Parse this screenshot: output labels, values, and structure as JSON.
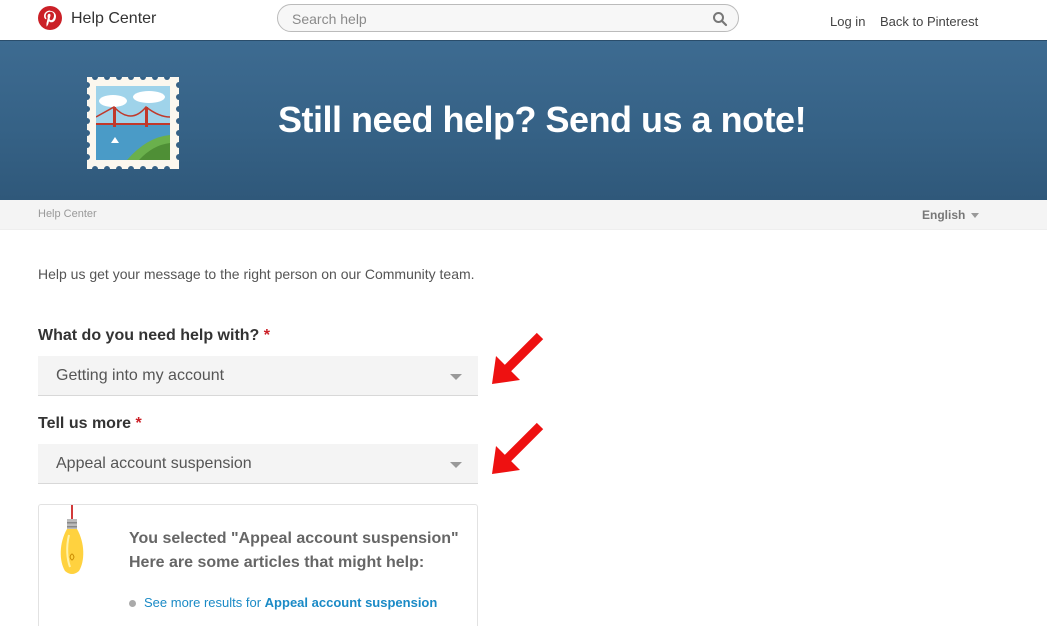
{
  "header": {
    "brand": "Help Center",
    "search_placeholder": "Search help",
    "login": "Log in",
    "back": "Back to Pinterest"
  },
  "banner": {
    "title": "Still need help? Send us a note!"
  },
  "crumbbar": {
    "breadcrumb": "Help Center",
    "language": "English"
  },
  "form": {
    "intro": "Help us get your message to the right person on our Community team.",
    "q1_label": "What do you need help with?",
    "q1_value": "Getting into my account",
    "q2_label": "Tell us more",
    "q2_value": "Appeal account suspension",
    "required_mark": "*"
  },
  "articles": {
    "line1": "You selected \"Appeal account suspension\"",
    "line2": "Here are some articles that might help:",
    "item_prefix": "See more results for",
    "item_query": "Appeal account suspension"
  },
  "colors": {
    "brand_red": "#cb2027",
    "banner_blue": "#356185",
    "link_blue": "#1a8ac6",
    "annotation_arrow": "#ee1111"
  }
}
